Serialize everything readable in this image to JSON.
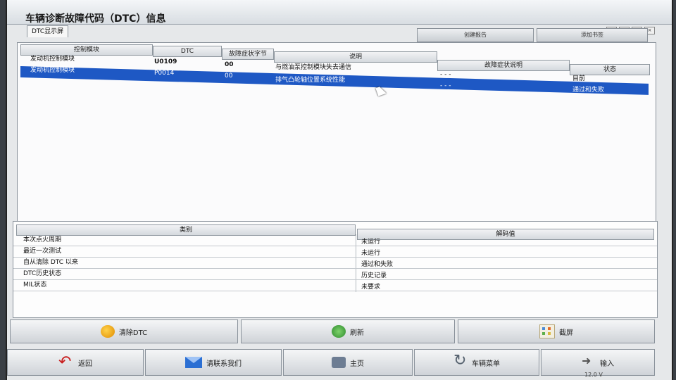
{
  "window": {
    "title": "车辆诊断故障代码（DTC）信息",
    "tab_label": "DTC显示屏",
    "controls": [
      "?",
      "_",
      "□",
      "×"
    ]
  },
  "top_buttons": [
    {
      "label": "创建报告"
    },
    {
      "label": "添加书签"
    }
  ],
  "dtc_table": {
    "headers": {
      "control_module": "控制模块",
      "dtc": "DTC",
      "symptom_byte": "故障症状字节",
      "description": "说明",
      "symptom_desc": "故障症状说明",
      "status": "状态"
    },
    "rows": [
      {
        "module": "发动机控制模块",
        "dtc": "U0109",
        "byte": "00",
        "description": "与燃油泵控制模块失去通信",
        "symptom": "- - -",
        "status": "目前"
      },
      {
        "module": "发动机控制模块",
        "dtc": "P0014",
        "byte": "00",
        "description": "排气凸轮轴位置系统性能",
        "symptom": "- - -",
        "status": "通过和失败"
      }
    ]
  },
  "info_table": {
    "headers": {
      "category": "类别",
      "value": "解码值"
    },
    "rows": [
      {
        "category": "本次点火周期",
        "value": "未运行"
      },
      {
        "category": "最近一次测试",
        "value": "未运行"
      },
      {
        "category": "自从清除 DTC 以来",
        "value": "通过和失败"
      },
      {
        "category": "DTC历史状态",
        "value": "历史记录"
      },
      {
        "category": "MIL状态",
        "value": "未要求"
      }
    ]
  },
  "action_buttons": {
    "clear": "清除DTC",
    "refresh": "刷新",
    "screenshot": "截屏"
  },
  "nav_buttons": {
    "back": "返回",
    "contact": "请联系我们",
    "home": "主页",
    "vehicle_menu": "车辆菜单",
    "input": "输入"
  },
  "status": {
    "voltage": "12.0 V"
  }
}
